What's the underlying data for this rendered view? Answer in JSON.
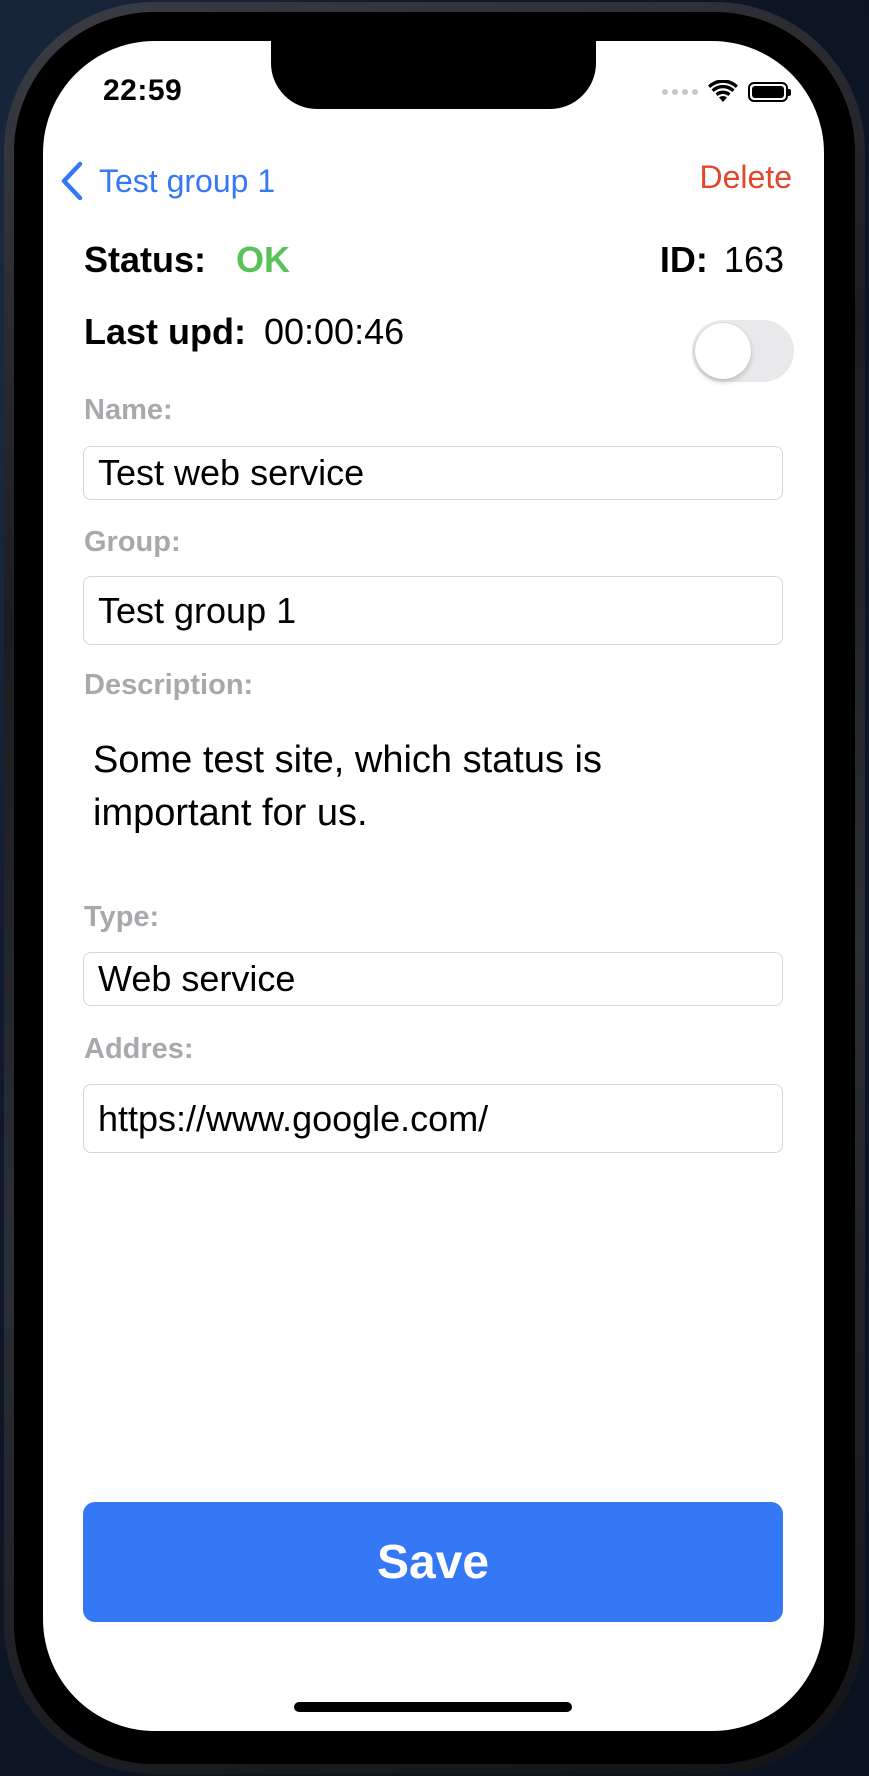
{
  "status_bar": {
    "time": "22:59",
    "icons": [
      "cellular-signal-icon",
      "wifi-icon",
      "battery-icon"
    ]
  },
  "nav": {
    "back_label": "Test group 1",
    "back_icon": "chevron-left-icon",
    "delete_label": "Delete"
  },
  "info": {
    "status_label": "Status:",
    "status_value": "OK",
    "id_label": "ID:",
    "id_value": "163",
    "last_upd_label": "Last upd:",
    "last_upd_value": "00:00:46",
    "toggle_on": false
  },
  "form": {
    "name_label": "Name:",
    "name_value": "Test web service",
    "group_label": "Group:",
    "group_value": "Test group 1",
    "description_label": "Description:",
    "description_value": "Some test site, which status is important for us.",
    "type_label": "Type:",
    "type_value": "Web service",
    "address_label": "Addres:",
    "address_value": "https://www.google.com/"
  },
  "actions": {
    "save_label": "Save"
  },
  "colors": {
    "accent": "#3478f6",
    "destructive": "#e1472b",
    "status_ok": "#58c359",
    "field_label": "#a9a9ad"
  }
}
